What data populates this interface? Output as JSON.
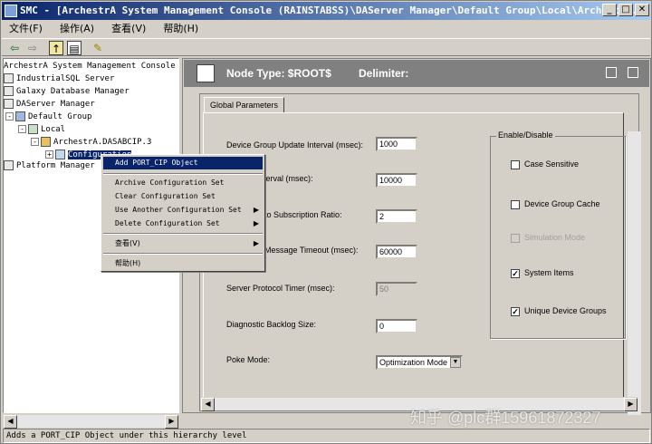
{
  "window": {
    "title": "SMC - [ArchestrA System Management Console (RAINSTABSS)\\DAServer Manager\\Default Group\\Local\\ArchestrA.DASA..."
  },
  "titlebar_buttons": [
    "_",
    "□",
    "✕"
  ],
  "menu": [
    "文件(F)",
    "操作(A)",
    "查看(V)",
    "帮助(H)"
  ],
  "toolbar": {
    "icons": [
      "back-icon",
      "forward-icon",
      "up-folder-icon",
      "show-tree-icon",
      "help-icon"
    ]
  },
  "tree": {
    "items": [
      {
        "label": "ArchestrA System Management Console (RA",
        "name": "tree-root"
      },
      {
        "label": "IndustrialSQL Server",
        "name": "tree-industrialsql"
      },
      {
        "label": "Galaxy Database Manager",
        "name": "tree-galaxy-db"
      },
      {
        "label": "DAServer Manager",
        "name": "tree-daserver"
      },
      {
        "label": "Default Group",
        "name": "tree-default-group"
      },
      {
        "label": "Local",
        "name": "tree-local"
      },
      {
        "label": "ArchestrA.DASABCIP.3",
        "name": "tree-dasabcip"
      },
      {
        "label": "Configuration",
        "name": "tree-configuration"
      },
      {
        "label": "Platform Manager",
        "name": "tree-platform-manager"
      }
    ]
  },
  "header": {
    "node_type": "Node Type: $ROOT$",
    "delimiter": "Delimiter:"
  },
  "tab": {
    "label": "Global Parameters"
  },
  "fields": [
    {
      "label": "Device Group Update Interval (msec):",
      "value": "1000",
      "disabled": false
    },
    {
      "label": "nterval (msec):",
      "value": "10000",
      "disabled": false
    },
    {
      "label": "to Subscription Ratio:",
      "value": "2",
      "disabled": false
    },
    {
      "label": "Message Timeout (msec):",
      "value": "60000",
      "disabled": false
    },
    {
      "label": "Server Protocol Timer (msec):",
      "value": "50",
      "disabled": true
    },
    {
      "label": "Diagnostic Backlog Size:",
      "value": "0",
      "disabled": false
    }
  ],
  "poke": {
    "label": "Poke Mode:",
    "value": "Optimization Mode"
  },
  "enable_group": {
    "title": "Enable/Disable",
    "items": [
      {
        "label": "Case Sensitive",
        "checked": false,
        "disabled": false
      },
      {
        "label": "Device Group Cache",
        "checked": false,
        "disabled": false
      },
      {
        "label": "Simulation Mode",
        "checked": false,
        "disabled": true
      },
      {
        "label": "System Items",
        "checked": true,
        "disabled": false
      },
      {
        "label": "Unique Device Groups",
        "checked": true,
        "disabled": false
      }
    ]
  },
  "context_menu": {
    "items": [
      {
        "label": "Add PORT_CIP Object",
        "highlighted": true,
        "submenu": false
      },
      {
        "label": "Archive Configuration Set",
        "highlighted": false,
        "submenu": false
      },
      {
        "label": "Clear Configuration Set",
        "highlighted": false,
        "submenu": false
      },
      {
        "label": "Use Another Configuration Set",
        "highlighted": false,
        "submenu": true
      },
      {
        "label": "Delete Configuration Set",
        "highlighted": false,
        "submenu": true
      },
      {
        "label": "查看(V)",
        "highlighted": false,
        "submenu": true
      },
      {
        "label": "帮助(H)",
        "highlighted": false,
        "submenu": false
      }
    ]
  },
  "status": {
    "text": "Adds a PORT_CIP Object under this hierarchy level"
  },
  "watermark": {
    "text": "知乎 @plc群15961872327"
  }
}
